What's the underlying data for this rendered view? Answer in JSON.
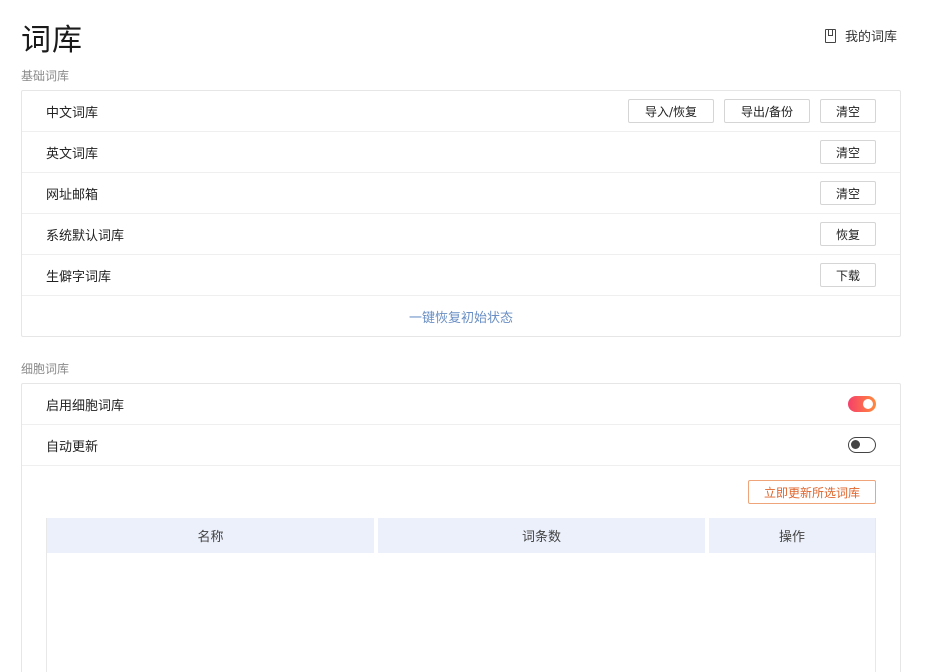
{
  "page": {
    "title": "词库"
  },
  "header": {
    "my_library_label": "我的词库"
  },
  "basic": {
    "section_label": "基础词库",
    "rows": [
      {
        "label": "中文词库",
        "buttons": [
          "导入/恢复",
          "导出/备份",
          "清空"
        ]
      },
      {
        "label": "英文词库",
        "buttons": [
          "清空"
        ]
      },
      {
        "label": "网址邮箱",
        "buttons": [
          "清空"
        ]
      },
      {
        "label": "系统默认词库",
        "buttons": [
          "恢复"
        ]
      },
      {
        "label": "生僻字词库",
        "buttons": [
          "下载"
        ]
      }
    ],
    "reset_label": "一键恢复初始状态"
  },
  "cell": {
    "section_label": "细胞词库",
    "enable": {
      "label": "启用细胞词库",
      "on": true
    },
    "auto_update": {
      "label": "自动更新",
      "on": false
    },
    "update_button": "立即更新所选词库",
    "table": {
      "columns": [
        "名称",
        "词条数",
        "操作"
      ],
      "rows": []
    }
  },
  "colors": {
    "accent_orange": "#e0642c",
    "link_blue": "#6a8fc4",
    "toggle_on_start": "#f5406a",
    "toggle_on_end": "#ff8a3c",
    "table_header_bg": "#ebf0fb"
  }
}
